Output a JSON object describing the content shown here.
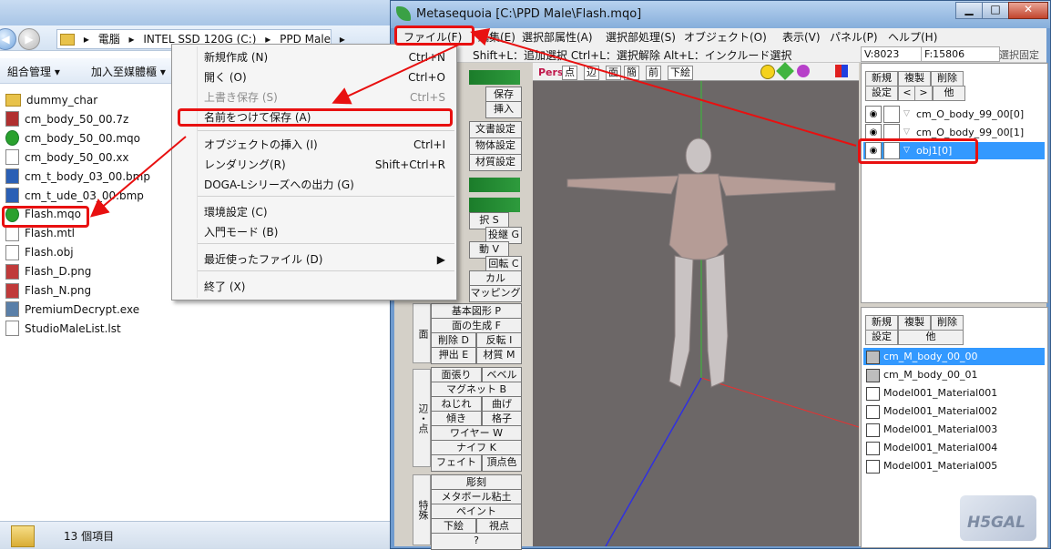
{
  "explorer": {
    "breadcrumb": [
      "電腦",
      "INTEL SSD 120G (C:)",
      "PPD Male"
    ],
    "toolbar": {
      "organize": "組合管理 ▾",
      "add_library": "加入至媒體櫃 ▾"
    },
    "files": [
      {
        "name": "dummy_char",
        "icon": "folder-icon",
        "color": "#e8c24a"
      },
      {
        "name": "cm_body_50_00.7z",
        "icon": "archive-icon",
        "color": "#b03030"
      },
      {
        "name": "cm_body_50_00.mqo",
        "icon": "mqo-file-icon",
        "color": "#2aa12e"
      },
      {
        "name": "cm_body_50_00.xx",
        "icon": "file-icon",
        "color": "#ffffff"
      },
      {
        "name": "cm_t_body_03_00.bmp",
        "icon": "bmp-icon",
        "color": "#2a5fb5"
      },
      {
        "name": "cm_t_ude_03_00.bmp",
        "icon": "bmp-icon",
        "color": "#2a5fb5"
      },
      {
        "name": "Flash.mqo",
        "icon": "mqo-file-icon",
        "color": "#2aa12e"
      },
      {
        "name": "Flash.mtl",
        "icon": "file-icon",
        "color": "#ffffff"
      },
      {
        "name": "Flash.obj",
        "icon": "file-icon",
        "color": "#ffffff"
      },
      {
        "name": "Flash_D.png",
        "icon": "png-icon",
        "color": "#c03a3a"
      },
      {
        "name": "Flash_N.png",
        "icon": "png-icon",
        "color": "#c03a3a"
      },
      {
        "name": "PremiumDecrypt.exe",
        "icon": "exe-icon",
        "color": "#5a7fa8"
      },
      {
        "name": "StudioMaleList.lst",
        "icon": "file-icon",
        "color": "#ffffff"
      }
    ],
    "status": "13 個項目"
  },
  "menu": {
    "items": [
      {
        "label": "新規作成 (N)",
        "shortcut": "Ctrl+N",
        "disabled": false
      },
      {
        "label": "開く (O)",
        "shortcut": "Ctrl+O",
        "disabled": false
      },
      {
        "label": "上書き保存 (S)",
        "shortcut": "Ctrl+S",
        "disabled": true
      },
      {
        "label": "名前をつけて保存 (A)",
        "shortcut": "",
        "disabled": false
      },
      {
        "label": "オブジェクトの挿入 (I)",
        "shortcut": "Ctrl+I",
        "disabled": false
      },
      {
        "label": "レンダリング(R)",
        "shortcut": "Shift+Ctrl+R",
        "disabled": false
      },
      {
        "label": "DOGA-Lシリーズへの出力 (G)",
        "shortcut": "",
        "disabled": false
      },
      {
        "label": "環境設定 (C)",
        "shortcut": "",
        "disabled": false
      },
      {
        "label": "入門モード (B)",
        "shortcut": "",
        "disabled": false
      },
      {
        "label": "最近使ったファイル (D)",
        "shortcut": "▶",
        "disabled": false
      },
      {
        "label": "終了 (X)",
        "shortcut": "",
        "disabled": false
      }
    ]
  },
  "mq": {
    "title": "Metasequoia [C:\\PPD Male\\Flash.mqo]",
    "menubar": [
      "ファイル(F)",
      "編集(E)",
      "選択部属性(A)",
      "選択部処理(S)",
      "オブジェクト(O)",
      "表示(V)",
      "パネル(P)",
      "ヘルプ(H)"
    ],
    "status_hint": "Shift+L：追加選択 Ctrl+L：選択解除 Alt+L：インクルード選択",
    "vertex_count": "V:8023",
    "face_count": "F:15806",
    "select_lock": "選択固定",
    "cmd_panel": {
      "upper": [
        "保存",
        "挿入",
        "文書設定",
        "物体設定",
        "材質設定",
        "択 S",
        "投継 G",
        "動 V",
        "回転 C",
        "カル",
        "マッピング"
      ],
      "face_label": "面",
      "face": [
        "基本図形 P",
        "面の生成 F",
        "削除 D",
        "反転 I",
        "押出 E",
        "材質 M"
      ],
      "edge_label": "辺・点",
      "edge": [
        "面張り",
        "ベベル",
        "マグネット B",
        "ねじれ",
        "曲げ",
        "傾き",
        "格子",
        "ワイヤー W",
        "ナイフ K",
        "フェイト",
        "頂点色"
      ],
      "special_label": "特殊",
      "special": [
        "彫刻",
        "メタボール粘土",
        "ペイント",
        "下絵",
        "視点",
        "?"
      ]
    },
    "viewport": {
      "mode": "Pers",
      "buttons": [
        "点",
        "辺",
        "面",
        "簡",
        "前",
        "下絵"
      ]
    },
    "object_panel": {
      "buttons": [
        "新規",
        "複製",
        "削除",
        "設定",
        "<",
        ">",
        "他"
      ],
      "objects": [
        {
          "name": "cm_O_body_99_00[0]",
          "selected": false
        },
        {
          "name": "cm_O_body_99_00[1]",
          "selected": false
        },
        {
          "name": "obj1[0]",
          "selected": true
        }
      ]
    },
    "material_panel": {
      "buttons": [
        "新規",
        "複製",
        "削除",
        "設定",
        "他"
      ],
      "materials": [
        {
          "name": "cm_M_body_00_00",
          "selected": true,
          "color": "#bdbdbd"
        },
        {
          "name": "cm_M_body_00_01",
          "selected": false,
          "color": "#bdbdbd"
        },
        {
          "name": "Model001_Material001",
          "selected": false,
          "color": "#ffffff"
        },
        {
          "name": "Model001_Material002",
          "selected": false,
          "color": "#ffffff"
        },
        {
          "name": "Model001_Material003",
          "selected": false,
          "color": "#ffffff"
        },
        {
          "name": "Model001_Material004",
          "selected": false,
          "color": "#ffffff"
        },
        {
          "name": "Model001_Material005",
          "selected": false,
          "color": "#ffffff"
        }
      ]
    },
    "watermark": "H5GAL"
  },
  "colors": {
    "highlight": "#e81010",
    "selection": "#3399ff"
  }
}
